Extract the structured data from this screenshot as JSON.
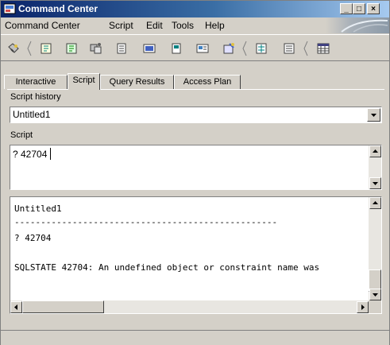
{
  "window": {
    "title": "Command Center"
  },
  "menu": [
    "Command Center",
    "Script",
    "Edit",
    "Tools",
    "Help"
  ],
  "toolbar": {
    "icons": [
      "connect-icon",
      "script-icon",
      "script-2-icon",
      "replication-icon",
      "table-icon",
      "show-icon",
      "db-icon",
      "query-icon",
      "wizard-icon",
      "results-icon",
      "list-icon",
      "grid-icon"
    ]
  },
  "tabs": [
    "Interactive",
    "Script",
    "Query Results",
    "Access Plan"
  ],
  "active_tab": "Script",
  "script_history": {
    "label": "Script history",
    "value": "Untitled1"
  },
  "script": {
    "label": "Script",
    "value": "? 42704"
  },
  "output": {
    "lines": [
      "Untitled1",
      "--------------------------------------------------",
      "? 42704",
      "",
      "SQLSTATE 42704: An undefined object or constraint name was"
    ]
  }
}
